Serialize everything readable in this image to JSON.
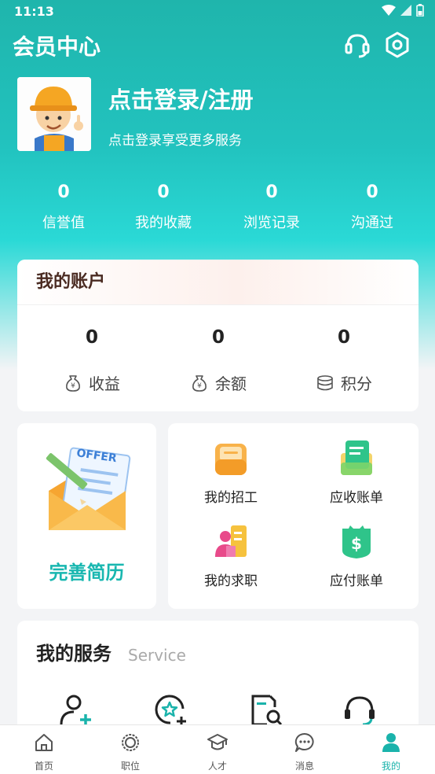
{
  "status_bar": {
    "time": "11:13"
  },
  "header": {
    "title": "会员中心",
    "icons": [
      "headset-icon",
      "settings-icon"
    ]
  },
  "profile": {
    "login_title": "点击登录/注册",
    "login_subtitle": "点击登录享受更多服务"
  },
  "stats": [
    {
      "value": "0",
      "label": "信誉值"
    },
    {
      "value": "0",
      "label": "我的收藏"
    },
    {
      "value": "0",
      "label": "浏览记录"
    },
    {
      "value": "0",
      "label": "沟通过"
    }
  ],
  "account": {
    "title": "我的账户",
    "items": [
      {
        "value": "0",
        "label": "收益",
        "icon": "money-bag-icon"
      },
      {
        "value": "0",
        "label": "余额",
        "icon": "money-bag-icon"
      },
      {
        "value": "0",
        "label": "积分",
        "icon": "coin-stack-icon"
      }
    ]
  },
  "resume": {
    "label": "完善简历",
    "offer_text": "OFFER"
  },
  "quick_grid": [
    {
      "label": "我的招工",
      "icon": "briefcase-icon"
    },
    {
      "label": "应收账单",
      "icon": "receivable-doc-icon"
    },
    {
      "label": "我的求职",
      "icon": "job-search-icon"
    },
    {
      "label": "应付账单",
      "icon": "payable-wallet-icon"
    }
  ],
  "services": {
    "title": "我的服务",
    "subtitle": "Service"
  },
  "tabbar": [
    {
      "label": "首页",
      "icon": "home-icon"
    },
    {
      "label": "职位",
      "icon": "position-icon"
    },
    {
      "label": "人才",
      "icon": "talent-icon"
    },
    {
      "label": "消息",
      "icon": "message-icon"
    },
    {
      "label": "我的",
      "icon": "profile-icon",
      "active": true
    }
  ],
  "colors": {
    "accent": "#1ab3ab",
    "hero_top": "#1fb5ac",
    "hero_mid": "#2ad9d6"
  }
}
